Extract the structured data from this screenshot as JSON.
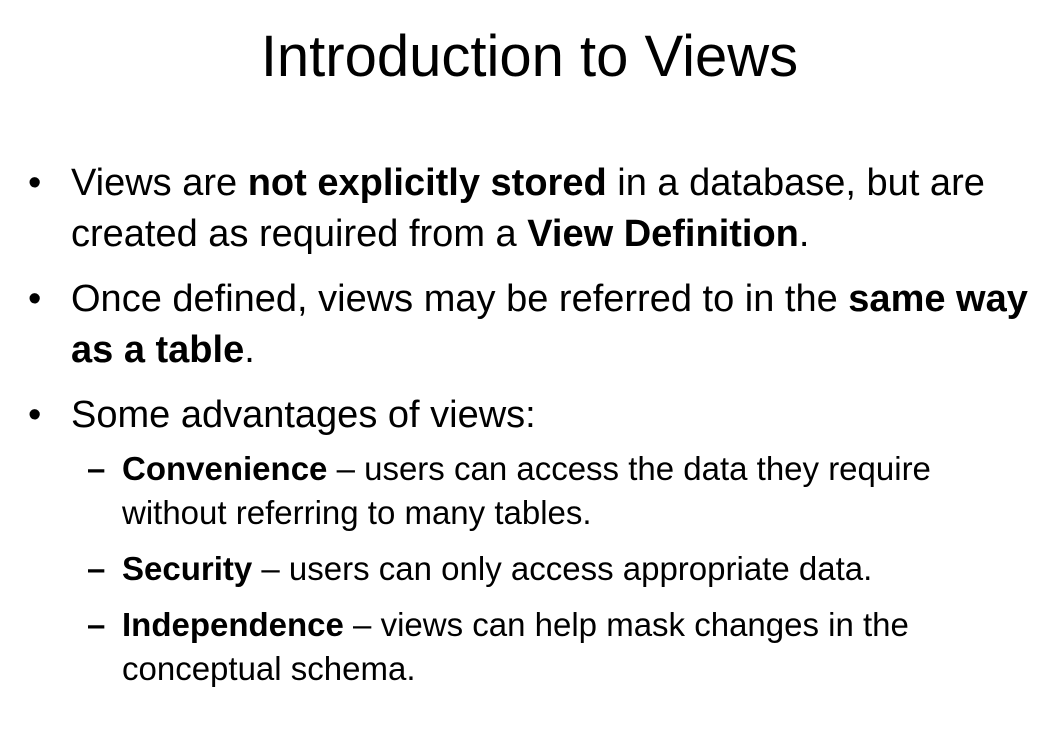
{
  "slide": {
    "title": "Introduction to Views",
    "bullet_symbol": "•",
    "dash_symbol": "–",
    "bullets": [
      {
        "pre": "Views are ",
        "bold": "not explicitly stored",
        "mid": " in a database, but are created as required from a ",
        "bold2": "View Definition",
        "post": "."
      },
      {
        "pre": "Once defined, views may be referred to in the ",
        "bold": "same way as a table",
        "post": "."
      },
      {
        "text": "Some advantages of views:",
        "subbullets": [
          {
            "term": "Convenience",
            "desc": " – users can access the data they require without referring to many tables."
          },
          {
            "term": "Security",
            "desc": " – users can only access appropriate data."
          },
          {
            "term": "Independence",
            "desc": " – views can help mask changes in the conceptual schema."
          }
        ]
      }
    ]
  }
}
